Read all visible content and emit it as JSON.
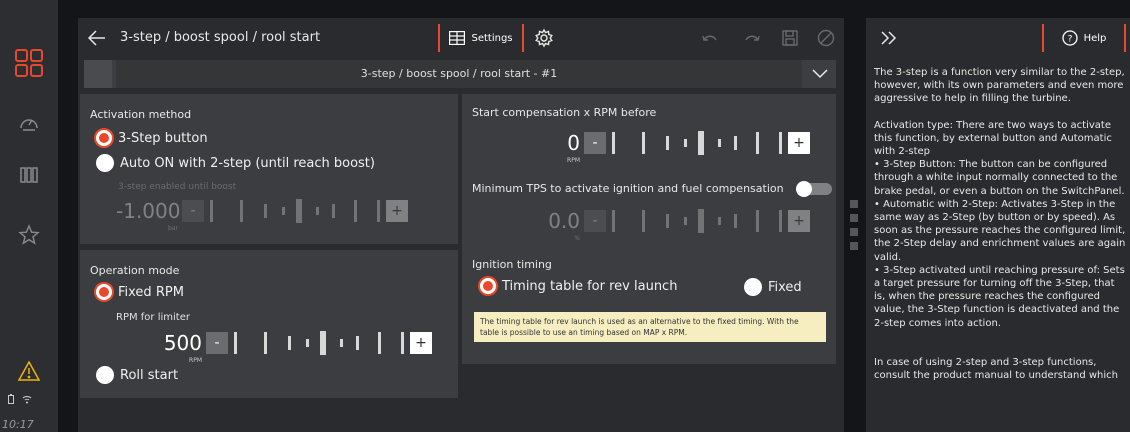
{
  "clock": "10:17",
  "header": {
    "title": "3-step / boost spool / rool start",
    "settings_label": "Settings"
  },
  "dropdown": {
    "value": "3-step / boost spool / rool start - #1"
  },
  "activation": {
    "title": "Activation method",
    "option1": "3-Step button",
    "option2": "Auto ON with 2-step (until reach boost)",
    "enabled_until_label": "3-step enabled until boost",
    "value": "-1.000",
    "unit": "bar"
  },
  "start_comp": {
    "title": "Start compensation x RPM before",
    "value": "0",
    "unit": "RPM"
  },
  "min_tps": {
    "title": "Minimum TPS to activate ignition and fuel compensation",
    "value": "0.0",
    "unit": "%"
  },
  "operation": {
    "title": "Operation mode",
    "option1": "Fixed RPM",
    "limiter_label": "RPM for limiter",
    "value": "500",
    "unit": "RPM",
    "option2": "Roll start"
  },
  "ignition": {
    "title": "Ignition timing",
    "option1": "Timing table for rev launch",
    "option2": "Fixed",
    "note": "The timing table for rev launch is used as an alternative to the fixed timing. With the table is possible to use an timing based on MAP x RPM."
  },
  "help": {
    "label": "Help",
    "p1": "The 3-step is a function very similar to the 2-step, however, with its own parameters and even more aggressive to help in filling the turbine.",
    "p2": "Activation type: There are two ways to activate this function, by external button and Automatic with 2-step",
    "p3": "• 3-Step Button: The button can be configured through a white input normally connected to the brake pedal, or even a button on the SwitchPanel.",
    "p4": "• Automatic with 2-Step: Activates 3-Step in the same way as 2-Step (by button or by speed). As soon as the pressure reaches the configured limit, the 2-Step delay and enrichment values are again valid.",
    "p5": "• 3-Step activated until reaching pressure of: Sets a target pressure for turning off the 3-Step, that is, when the pressure reaches the configured value, the 3-Step function is deactivated and the 2-step comes into action.",
    "p6": "In case of using 2-step and 3-step functions, consult the product manual to understand which"
  },
  "colors": {
    "accent": "#e8482c",
    "panel": "#3c3d40",
    "background": "#2a2b2e"
  }
}
